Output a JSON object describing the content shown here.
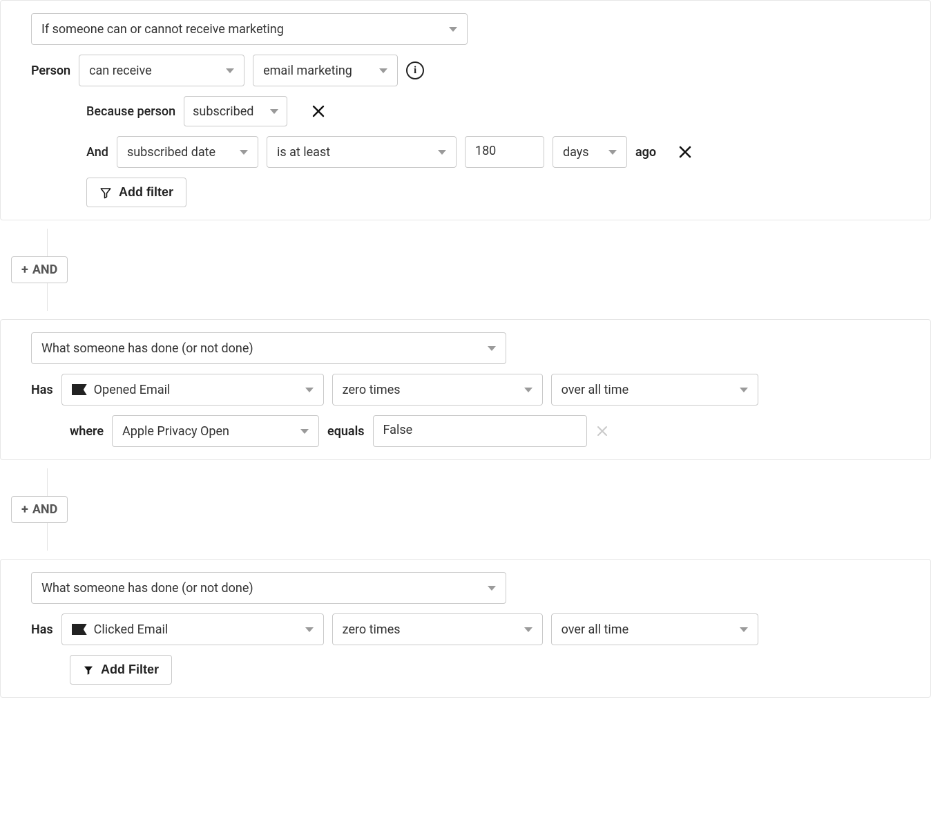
{
  "connectors": {
    "and_label": "AND"
  },
  "buttons": {
    "add_filter_outline": "Add filter",
    "add_filter_solid": "Add Filter"
  },
  "block1": {
    "condition_type": "If someone can or cannot receive marketing",
    "person_label": "Person",
    "can_receive": "can receive",
    "marketing_channel": "email marketing",
    "because_label": "Because person",
    "because_value": "subscribed",
    "and_label": "And",
    "date_field": "subscribed date",
    "comparator": "is at least",
    "number": "180",
    "unit": "days",
    "ago_label": "ago"
  },
  "block2": {
    "condition_type": "What someone has done (or not done)",
    "has_label": "Has",
    "metric": "Opened Email",
    "times": "zero times",
    "timeframe": "over all time",
    "where_label": "where",
    "where_property": "Apple Privacy Open",
    "equals_label": "equals",
    "where_value": "False"
  },
  "block3": {
    "condition_type": "What someone has done (or not done)",
    "has_label": "Has",
    "metric": "Clicked Email",
    "times": "zero times",
    "timeframe": "over all time"
  }
}
